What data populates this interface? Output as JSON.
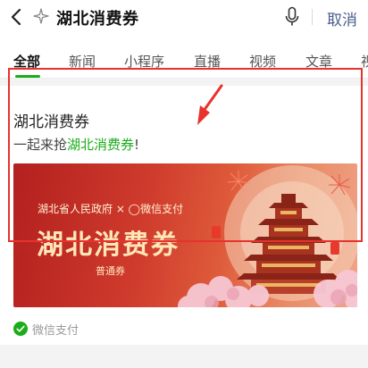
{
  "search": {
    "query": "湖北消费券",
    "cancel_label": "取消"
  },
  "tabs": [
    {
      "label": "全部",
      "active": true
    },
    {
      "label": "新闻"
    },
    {
      "label": "小程序"
    },
    {
      "label": "直播"
    },
    {
      "label": "视频"
    },
    {
      "label": "文章"
    },
    {
      "label": "视"
    }
  ],
  "result": {
    "title": "湖北消费券",
    "desc_prefix": "一起来抢",
    "desc_highlight": "湖北消费券",
    "desc_suffix": "!",
    "banner": {
      "issuer_line": "湖北省人民政府 × ◯微信支付",
      "headline": "湖北消费券",
      "subline": "普通券"
    },
    "source_label": "微信支付"
  },
  "colors": {
    "accent_green": "#1aad19",
    "cancel_blue": "#4a5d8c",
    "annotation_red": "#e8322e"
  }
}
